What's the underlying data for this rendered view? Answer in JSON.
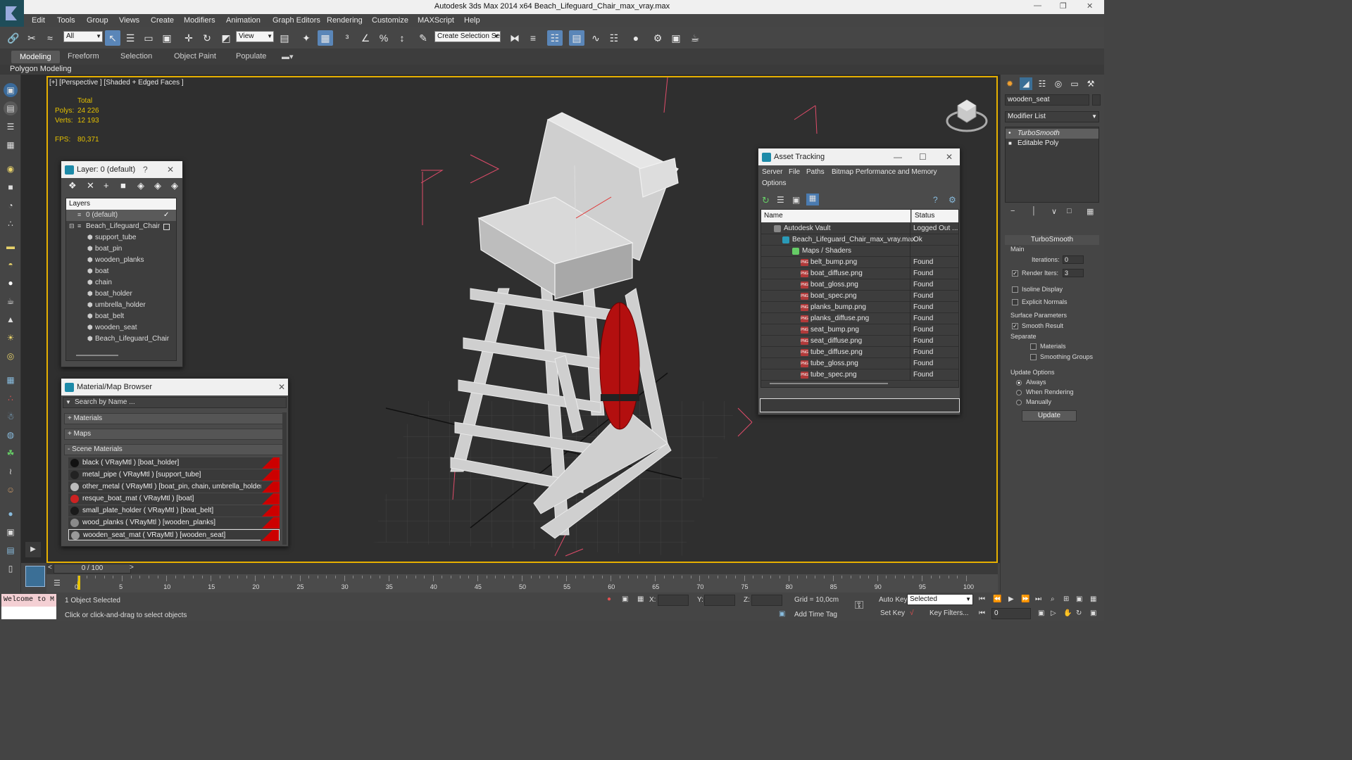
{
  "title": "Autodesk 3ds Max  2014 x64    Beach_Lifeguard_Chair_max_vray.max",
  "menu": [
    "Edit",
    "Tools",
    "Group",
    "Views",
    "Create",
    "Modifiers",
    "Animation",
    "Graph Editors",
    "Rendering",
    "Customize",
    "MAXScript",
    "Help"
  ],
  "toolbar": {
    "filter": "All",
    "refcoord": "View",
    "selset": "Create Selection Se"
  },
  "ribbon": {
    "tabs": [
      "Modeling",
      "Freeform",
      "Selection",
      "Object Paint",
      "Populate"
    ],
    "sub": "Polygon Modeling"
  },
  "viewport": {
    "label": "[+] [Perspective ] [Shaded + Edged Faces ]",
    "stats": {
      "total": "Total",
      "polys_label": "Polys:",
      "polys": "24 226",
      "verts_label": "Verts:",
      "verts": "12 193",
      "fps_label": "FPS:",
      "fps": "80,371"
    }
  },
  "layer_window": {
    "title": "Layer: 0 (default)",
    "help": "?",
    "header": "Layers",
    "items": [
      "0 (default)",
      "Beach_Lifeguard_Chair",
      "support_tube",
      "boat_pin",
      "wooden_planks",
      "boat",
      "chain",
      "boat_holder",
      "umbrella_holder",
      "boat_belt",
      "wooden_seat",
      "Beach_Lifeguard_Chair"
    ]
  },
  "material_browser": {
    "title": "Material/Map Browser",
    "search_placeholder": "Search by Name ...",
    "groups": [
      "+ Materials",
      "+ Maps",
      "- Scene Materials"
    ],
    "materials": [
      {
        "label": "black  ( VRayMtl ) [boat_holder]",
        "color": "#111111"
      },
      {
        "label": "metal_pipe  ( VRayMtl ) [support_tube]",
        "color": "#222222"
      },
      {
        "label": "other_metal  ( VRayMtl ) [boat_pin, chain, umbrella_holder]",
        "color": "#bbbbbb"
      },
      {
        "label": "resque_boat_mat  ( VRayMtl ) [boat]",
        "color": "#cc2222"
      },
      {
        "label": "small_plate_holder  ( VRayMtl ) [boat_belt]",
        "color": "#1a1a1a"
      },
      {
        "label": "wood_planks  ( VRayMtl ) [wooden_planks]",
        "color": "#8a8a8a"
      },
      {
        "label": "wooden_seat_mat  ( VRayMtl ) [wooden_seat]",
        "color": "#999999"
      }
    ]
  },
  "asset_tracking": {
    "title": "Asset Tracking",
    "menu": [
      "Server",
      "File",
      "Paths",
      "Bitmap Performance and Memory",
      "Options"
    ],
    "columns": [
      "Name",
      "Status"
    ],
    "rows": [
      {
        "name": "Autodesk Vault",
        "status": "Logged Out ...",
        "indent": 0
      },
      {
        "name": "Beach_Lifeguard_Chair_max_vray.max",
        "status": "Ok",
        "indent": 1
      },
      {
        "name": "Maps / Shaders",
        "status": "",
        "indent": 2
      },
      {
        "name": "belt_bump.png",
        "status": "Found",
        "indent": 3
      },
      {
        "name": "boat_diffuse.png",
        "status": "Found",
        "indent": 3
      },
      {
        "name": "boat_gloss.png",
        "status": "Found",
        "indent": 3
      },
      {
        "name": "boat_spec.png",
        "status": "Found",
        "indent": 3
      },
      {
        "name": "planks_bump.png",
        "status": "Found",
        "indent": 3
      },
      {
        "name": "planks_diffuse.png",
        "status": "Found",
        "indent": 3
      },
      {
        "name": "seat_bump.png",
        "status": "Found",
        "indent": 3
      },
      {
        "name": "seat_diffuse.png",
        "status": "Found",
        "indent": 3
      },
      {
        "name": "tube_diffuse.png",
        "status": "Found",
        "indent": 3
      },
      {
        "name": "tube_gloss.png",
        "status": "Found",
        "indent": 3
      },
      {
        "name": "tube_spec.png",
        "status": "Found",
        "indent": 3
      }
    ]
  },
  "command_panel": {
    "object_name": "wooden_seat",
    "modifier_list": "Modifier List",
    "stack": [
      "TurboSmooth",
      "Editable Poly"
    ],
    "rollout": "TurboSmooth",
    "main": "Main",
    "iterations_label": "Iterations:",
    "iterations": "0",
    "render_iters_label": "Render Iters:",
    "render_iters": "3",
    "isoline": "Isoline Display",
    "explicit_normals": "Explicit Normals",
    "surface_params": "Surface Parameters",
    "smooth_result": "Smooth Result",
    "separate": "Separate",
    "materials": "Materials",
    "smoothing_groups": "Smoothing Groups",
    "update_options": "Update Options",
    "always": "Always",
    "when_rendering": "When Rendering",
    "manually": "Manually",
    "update_button": "Update"
  },
  "timeline": {
    "frame": "0 / 100",
    "ticks": [
      "0",
      "5",
      "10",
      "15",
      "20",
      "25",
      "30",
      "35",
      "40",
      "45",
      "50",
      "55",
      "60",
      "65",
      "70",
      "75",
      "80",
      "85",
      "90",
      "95",
      "100"
    ]
  },
  "status": {
    "welcome": "Welcome to M",
    "selected": "1 Object Selected",
    "prompt": "Click or click-and-drag to select objects",
    "x": "X:",
    "y": "Y:",
    "z": "Z:",
    "grid": "Grid = 10,0cm",
    "add_time_tag": "Add Time Tag",
    "auto_key": "Auto Key",
    "set_key": "Set Key",
    "key_mode": "Selected",
    "key_filters": "Key Filters...",
    "frame_field": "0"
  }
}
